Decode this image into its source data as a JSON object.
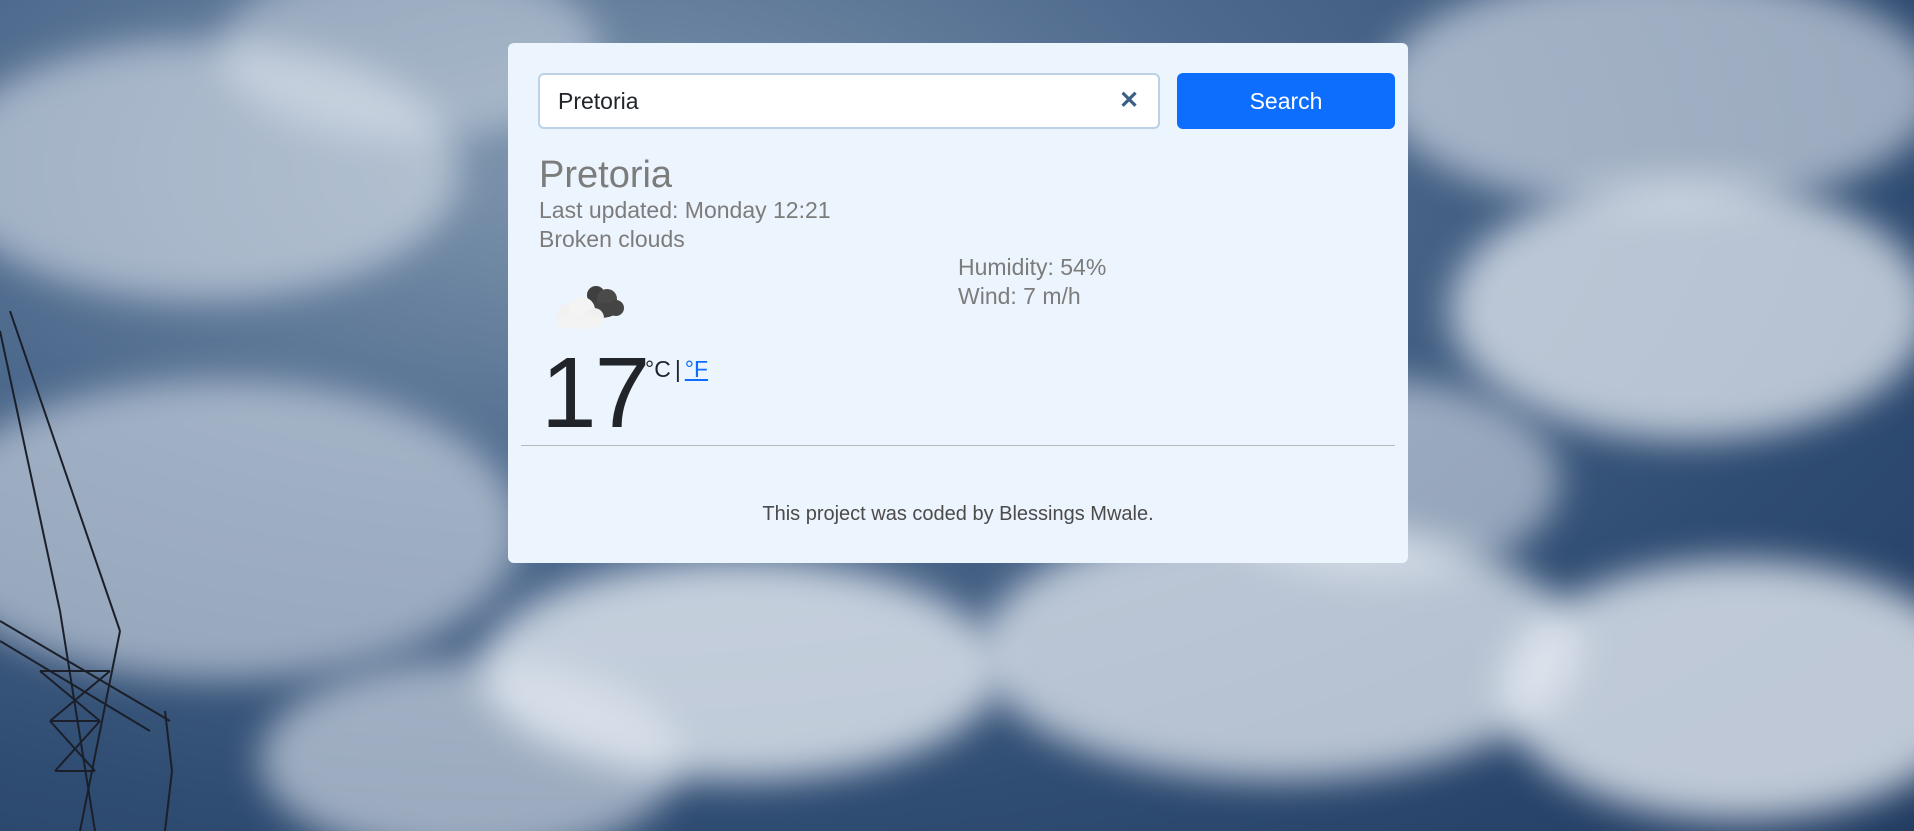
{
  "search": {
    "value": "Pretoria",
    "button_label": "Search",
    "clear_icon": "close-icon"
  },
  "weather": {
    "city": "Pretoria",
    "last_updated": "Last updated: Monday 12:21",
    "description": "Broken clouds",
    "humidity": "Humidity: 54%",
    "wind": "Wind: 7 m/h",
    "temperature": "17",
    "unit_celsius": "°C",
    "unit_separator": "|",
    "unit_fahrenheit": "°F",
    "icon": "broken-clouds-icon"
  },
  "footer": {
    "text": "This project was coded by Blessings Mwale."
  },
  "colors": {
    "card_background": "#ecf4fd",
    "button": "#0d6efd",
    "muted_text": "#7c7c7c"
  }
}
